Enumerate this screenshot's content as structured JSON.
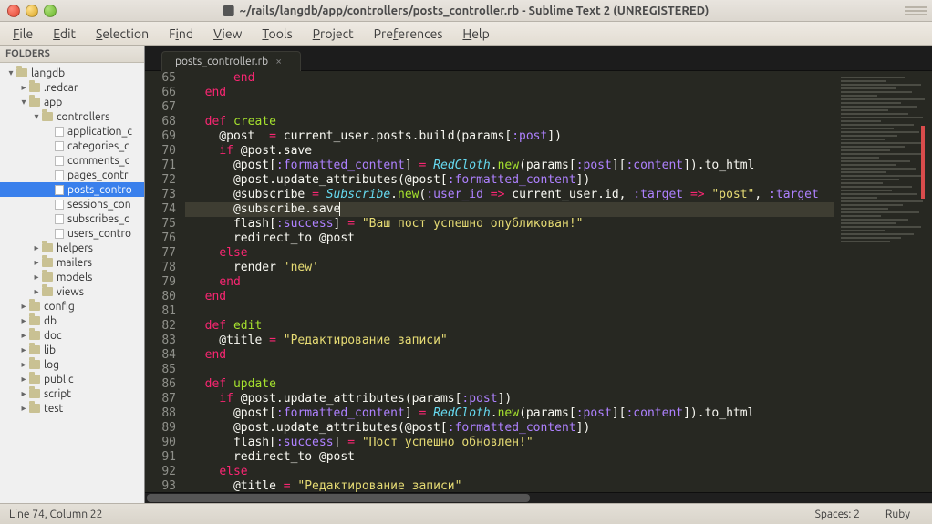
{
  "window": {
    "title": "~/rails/langdb/app/controllers/posts_controller.rb - Sublime Text 2 (UNREGISTERED)"
  },
  "menu": {
    "file": "File",
    "edit": "Edit",
    "selection": "Selection",
    "find": "Find",
    "view": "View",
    "tools": "Tools",
    "project": "Project",
    "preferences": "Preferences",
    "help": "Help"
  },
  "sidebar": {
    "header": "FOLDERS",
    "items": [
      {
        "indent": 0,
        "twisty": "▾",
        "type": "folder",
        "label": "langdb"
      },
      {
        "indent": 1,
        "twisty": "▸",
        "type": "folder",
        "label": ".redcar"
      },
      {
        "indent": 1,
        "twisty": "▾",
        "type": "folder",
        "label": "app"
      },
      {
        "indent": 2,
        "twisty": "▾",
        "type": "folder",
        "label": "controllers"
      },
      {
        "indent": 3,
        "twisty": "",
        "type": "file",
        "label": "application_c"
      },
      {
        "indent": 3,
        "twisty": "",
        "type": "file",
        "label": "categories_c"
      },
      {
        "indent": 3,
        "twisty": "",
        "type": "file",
        "label": "comments_c"
      },
      {
        "indent": 3,
        "twisty": "",
        "type": "file",
        "label": "pages_contr"
      },
      {
        "indent": 3,
        "twisty": "",
        "type": "file",
        "label": "posts_contro",
        "selected": true
      },
      {
        "indent": 3,
        "twisty": "",
        "type": "file",
        "label": "sessions_con"
      },
      {
        "indent": 3,
        "twisty": "",
        "type": "file",
        "label": "subscribes_c"
      },
      {
        "indent": 3,
        "twisty": "",
        "type": "file",
        "label": "users_contro"
      },
      {
        "indent": 2,
        "twisty": "▸",
        "type": "folder",
        "label": "helpers"
      },
      {
        "indent": 2,
        "twisty": "▸",
        "type": "folder",
        "label": "mailers"
      },
      {
        "indent": 2,
        "twisty": "▸",
        "type": "folder",
        "label": "models"
      },
      {
        "indent": 2,
        "twisty": "▸",
        "type": "folder",
        "label": "views"
      },
      {
        "indent": 1,
        "twisty": "▸",
        "type": "folder",
        "label": "config"
      },
      {
        "indent": 1,
        "twisty": "▸",
        "type": "folder",
        "label": "db"
      },
      {
        "indent": 1,
        "twisty": "▸",
        "type": "folder",
        "label": "doc"
      },
      {
        "indent": 1,
        "twisty": "▸",
        "type": "folder",
        "label": "lib"
      },
      {
        "indent": 1,
        "twisty": "▸",
        "type": "folder",
        "label": "log"
      },
      {
        "indent": 1,
        "twisty": "▸",
        "type": "folder",
        "label": "public"
      },
      {
        "indent": 1,
        "twisty": "▸",
        "type": "folder",
        "label": "script"
      },
      {
        "indent": 1,
        "twisty": "▸",
        "type": "folder",
        "label": "test"
      }
    ]
  },
  "tab": {
    "label": "posts_controller.rb",
    "close": "×"
  },
  "gutter": {
    "start": 65,
    "end": 93
  },
  "code": {
    "lines": [
      {
        "n": 65,
        "html": "      <span class='kw'>end</span>"
      },
      {
        "n": 66,
        "html": "  <span class='kw'>end</span>"
      },
      {
        "n": 67,
        "html": ""
      },
      {
        "n": 68,
        "html": "  <span class='kw'>def</span> <span class='fn'>create</span>"
      },
      {
        "n": 69,
        "html": "    @post  <span class='op'>=</span> current_user.posts.build(params[<span class='sym'>:post</span>])"
      },
      {
        "n": 70,
        "html": "    <span class='kw'>if</span> @post.save"
      },
      {
        "n": 71,
        "html": "      @post[<span class='sym'>:formatted_content</span>] <span class='op'>=</span> <span class='cls'>RedCloth</span>.<span class='fn'>new</span>(params[<span class='sym'>:post</span>][<span class='sym'>:content</span>]).to_html"
      },
      {
        "n": 72,
        "html": "      @post.update_attributes(@post[<span class='sym'>:formatted_content</span>])"
      },
      {
        "n": 73,
        "html": "      @subscribe <span class='op'>=</span> <span class='cls'>Subscribe</span>.<span class='fn'>new</span>(<span class='sym'>:user_id</span> <span class='op'>=&gt;</span> current_user.id, <span class='sym'>:target</span> <span class='op'>=&gt;</span> <span class='str'>\"post\"</span>, <span class='sym'>:target</span>"
      },
      {
        "n": 74,
        "html": "      @subscribe.save<span class='caret'></span>",
        "current": true
      },
      {
        "n": 75,
        "html": "      flash[<span class='sym'>:success</span>] <span class='op'>=</span> <span class='str'>\"Ваш пост успешно опубликован!\"</span>"
      },
      {
        "n": 76,
        "html": "      redirect_to @post"
      },
      {
        "n": 77,
        "html": "    <span class='kw'>else</span>"
      },
      {
        "n": 78,
        "html": "      render <span class='str'>'new'</span>"
      },
      {
        "n": 79,
        "html": "    <span class='kw'>end</span>"
      },
      {
        "n": 80,
        "html": "  <span class='kw'>end</span>"
      },
      {
        "n": 81,
        "html": ""
      },
      {
        "n": 82,
        "html": "  <span class='kw'>def</span> <span class='fn'>edit</span>"
      },
      {
        "n": 83,
        "html": "    @title <span class='op'>=</span> <span class='str'>\"Редактирование записи\"</span>"
      },
      {
        "n": 84,
        "html": "  <span class='kw'>end</span>"
      },
      {
        "n": 85,
        "html": ""
      },
      {
        "n": 86,
        "html": "  <span class='kw'>def</span> <span class='fn'>update</span>"
      },
      {
        "n": 87,
        "html": "    <span class='kw'>if</span> @post.update_attributes(params[<span class='sym'>:post</span>])"
      },
      {
        "n": 88,
        "html": "      @post[<span class='sym'>:formatted_content</span>] <span class='op'>=</span> <span class='cls'>RedCloth</span>.<span class='fn'>new</span>(params[<span class='sym'>:post</span>][<span class='sym'>:content</span>]).to_html"
      },
      {
        "n": 89,
        "html": "      @post.update_attributes(@post[<span class='sym'>:formatted_content</span>])"
      },
      {
        "n": 90,
        "html": "      flash[<span class='sym'>:success</span>] <span class='op'>=</span> <span class='str'>\"Пост успешно обновлен!\"</span>"
      },
      {
        "n": 91,
        "html": "      redirect_to @post"
      },
      {
        "n": 92,
        "html": "    <span class='kw'>else</span>"
      },
      {
        "n": 93,
        "html": "      @title <span class='op'>=</span> <span class='str'>\"Редактирование записи\"</span>"
      }
    ]
  },
  "status": {
    "position": "Line 74, Column 22",
    "spaces": "Spaces: 2",
    "syntax": "Ruby"
  }
}
